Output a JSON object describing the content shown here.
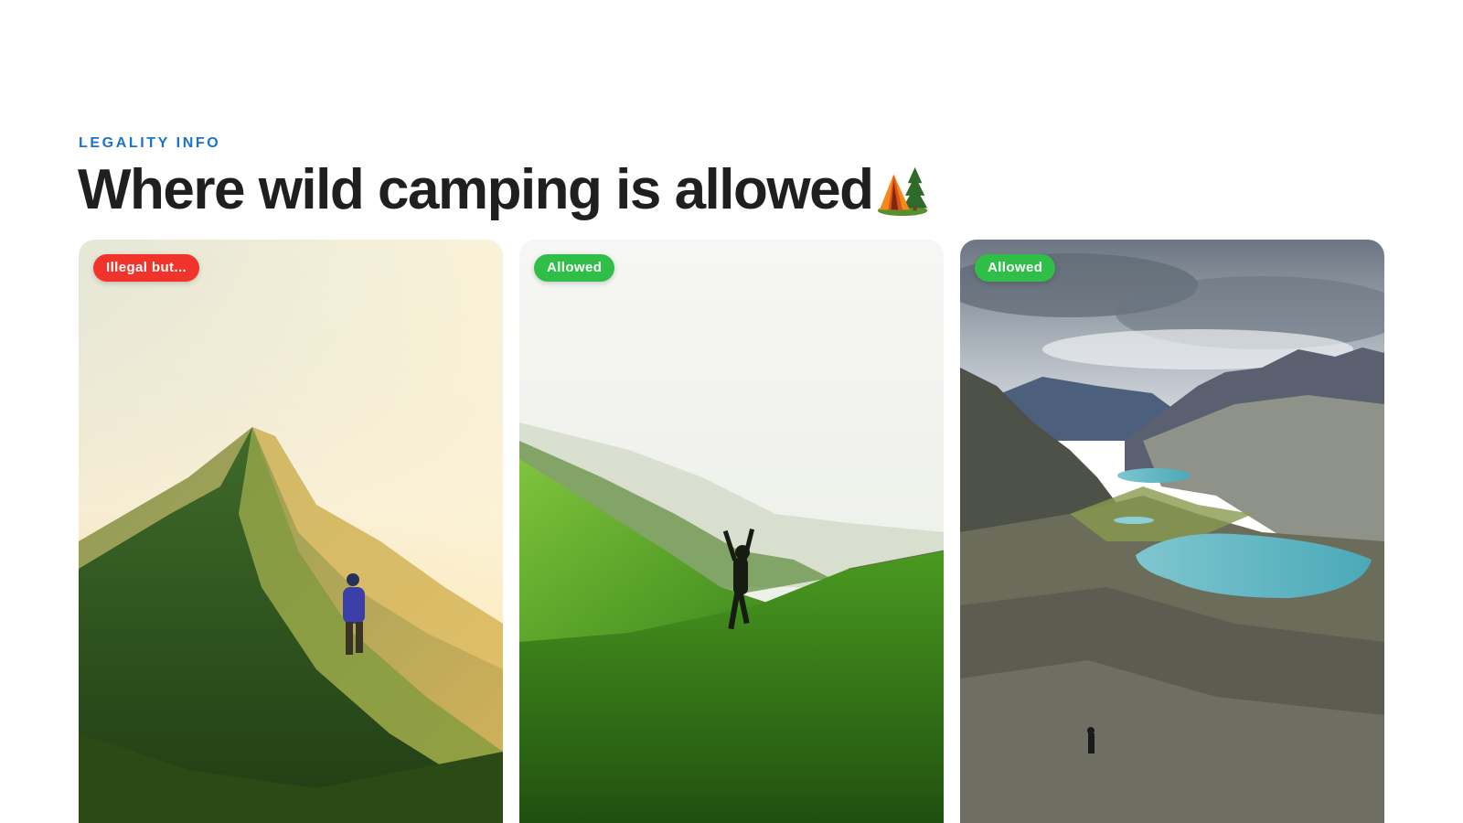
{
  "section": {
    "eyebrow": "LEGALITY INFO",
    "title": "Where wild camping is allowed",
    "title_emoji_icon": "camping-tent-icon"
  },
  "cards": [
    {
      "badge": "Illegal but...",
      "badge_status": "illegal",
      "badge_color": "#f0342c",
      "image": "hiker on grassy mountain ridge at sunset"
    },
    {
      "badge": "Allowed",
      "badge_status": "allowed",
      "badge_color": "#2fbf48",
      "image": "person raising arms on green misty hillside"
    },
    {
      "badge": "Allowed",
      "badge_status": "allowed",
      "badge_color": "#2fbf48",
      "image": "alpine valley with turquoise lakes and rocky slopes"
    }
  ],
  "colors": {
    "accent": "#1a73c8",
    "heading": "#1f1f1f"
  }
}
